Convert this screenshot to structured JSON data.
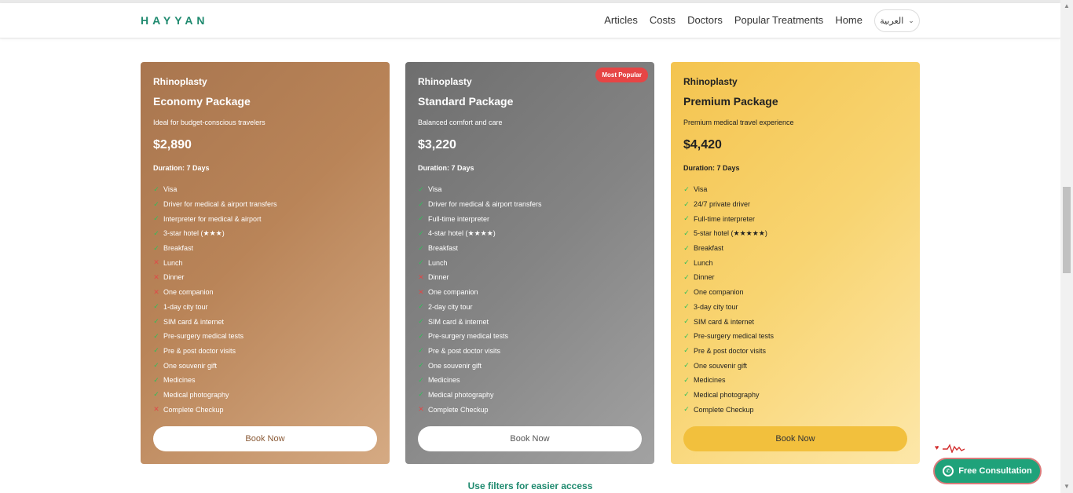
{
  "header": {
    "logo": "HAYYAN",
    "nav": [
      "Articles",
      "Costs",
      "Doctors",
      "Popular Treatments",
      "Home"
    ],
    "language": "العربية"
  },
  "cards": [
    {
      "procedure": "Rhinoplasty",
      "title": "Economy Package",
      "description": "Ideal for budget-conscious travelers",
      "price": "$2,890",
      "duration": "Duration: 7 Days",
      "features": [
        {
          "label": "Visa",
          "included": true
        },
        {
          "label": "Driver for medical & airport transfers",
          "included": true
        },
        {
          "label": "Interpreter for medical & airport",
          "included": true
        },
        {
          "label": "3-star hotel (★★★)",
          "included": true
        },
        {
          "label": "Breakfast",
          "included": true
        },
        {
          "label": "Lunch",
          "included": false
        },
        {
          "label": "Dinner",
          "included": false
        },
        {
          "label": "One companion",
          "included": false
        },
        {
          "label": "1-day city tour",
          "included": true
        },
        {
          "label": "SIM card & internet",
          "included": true
        },
        {
          "label": "Pre-surgery medical tests",
          "included": true
        },
        {
          "label": "Pre & post doctor visits",
          "included": true
        },
        {
          "label": "One souvenir gift",
          "included": true
        },
        {
          "label": "Medicines",
          "included": true
        },
        {
          "label": "Medical photography",
          "included": true
        },
        {
          "label": "Complete Checkup",
          "included": false
        }
      ],
      "button": "Book Now"
    },
    {
      "procedure": "Rhinoplasty",
      "title": "Standard Package",
      "description": "Balanced comfort and care",
      "price": "$3,220",
      "duration": "Duration: 7 Days",
      "badge": "Most Popular",
      "features": [
        {
          "label": "Visa",
          "included": true
        },
        {
          "label": "Driver for medical & airport transfers",
          "included": true
        },
        {
          "label": "Full-time interpreter",
          "included": true
        },
        {
          "label": "4-star hotel (★★★★)",
          "included": true
        },
        {
          "label": "Breakfast",
          "included": true
        },
        {
          "label": "Lunch",
          "included": true
        },
        {
          "label": "Dinner",
          "included": false
        },
        {
          "label": "One companion",
          "included": false
        },
        {
          "label": "2-day city tour",
          "included": true
        },
        {
          "label": "SIM card & internet",
          "included": true
        },
        {
          "label": "Pre-surgery medical tests",
          "included": true
        },
        {
          "label": "Pre & post doctor visits",
          "included": true
        },
        {
          "label": "One souvenir gift",
          "included": true
        },
        {
          "label": "Medicines",
          "included": true
        },
        {
          "label": "Medical photography",
          "included": true
        },
        {
          "label": "Complete Checkup",
          "included": false
        }
      ],
      "button": "Book Now"
    },
    {
      "procedure": "Rhinoplasty",
      "title": "Premium Package",
      "description": "Premium medical travel experience",
      "price": "$4,420",
      "duration": "Duration: 7 Days",
      "features": [
        {
          "label": "Visa",
          "included": true
        },
        {
          "label": "24/7 private driver",
          "included": true
        },
        {
          "label": "Full-time interpreter",
          "included": true
        },
        {
          "label": "5-star hotel (★★★★★)",
          "included": true
        },
        {
          "label": "Breakfast",
          "included": true
        },
        {
          "label": "Lunch",
          "included": true
        },
        {
          "label": "Dinner",
          "included": true
        },
        {
          "label": "One companion",
          "included": true
        },
        {
          "label": "3-day city tour",
          "included": true
        },
        {
          "label": "SIM card & internet",
          "included": true
        },
        {
          "label": "Pre-surgery medical tests",
          "included": true
        },
        {
          "label": "Pre & post doctor visits",
          "included": true
        },
        {
          "label": "One souvenir gift",
          "included": true
        },
        {
          "label": "Medicines",
          "included": true
        },
        {
          "label": "Medical photography",
          "included": true
        },
        {
          "label": "Complete Checkup",
          "included": true
        }
      ],
      "button": "Book Now"
    }
  ],
  "filters_link": "Use filters for easier access",
  "consult_button": "Free Consultation",
  "icons": {
    "included": "check-icon",
    "excluded": "cross-icon",
    "consult": "whatsapp-icon",
    "language": "chevron-down-icon"
  },
  "colors": {
    "brand": "#1f8a6f",
    "badge": "#e64545",
    "economy": "#b98458",
    "standard": "#848484",
    "premium": "#f8d471"
  }
}
